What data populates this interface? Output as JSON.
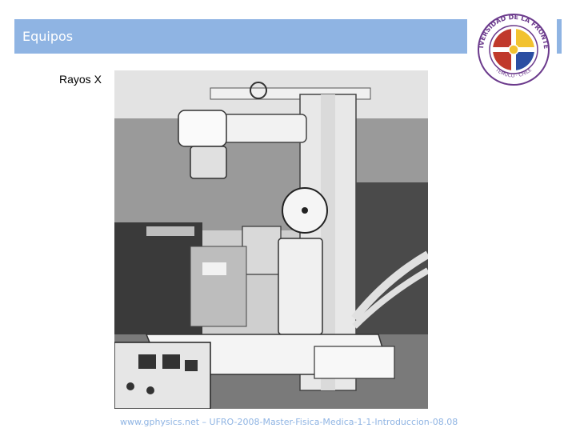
{
  "slide": {
    "title": "Equipos",
    "section_label": "Rayos X",
    "footer": "www.gphysics.net – UFRO-2008-Master-Fisica-Medica-1-1-Introduccion-08.08"
  },
  "logo": {
    "ring_text": "UNIVERSIDAD DE LA FRONTERA",
    "bottom_text": "TEMUCO · CHILE"
  },
  "photo": {
    "icon": "xray-equipment-photo"
  },
  "colors": {
    "accent": "#8fb4e3",
    "logo_red": "#c0392b",
    "logo_blue": "#2b4ea2",
    "logo_yellow": "#f2c230",
    "logo_purple": "#6b3a8c"
  }
}
